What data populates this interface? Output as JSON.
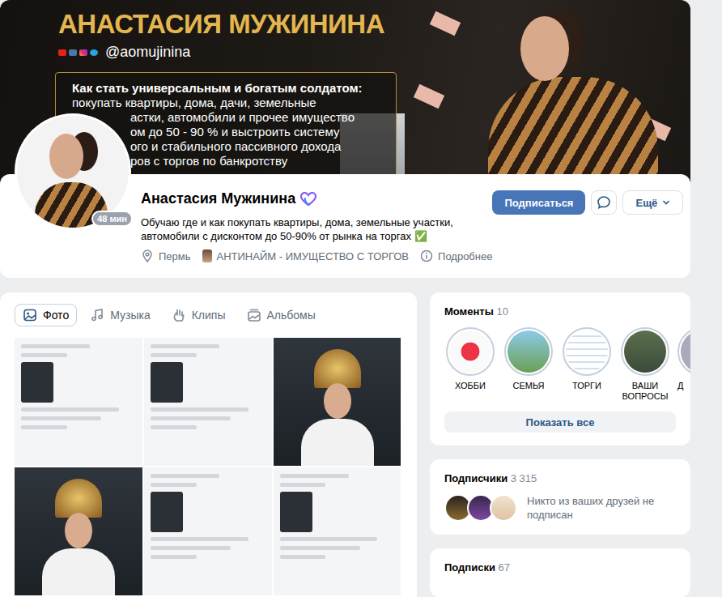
{
  "cover": {
    "title": "АНАСТАСИЯ МУЖИНИНА",
    "handle": "@aomujinina",
    "heading": "Как стать универсальным и богатым солдатом:",
    "lines": [
      "покупать квартиры, дома, дачи, земельные",
      "астки, автомобили и прочее имущество",
      "ом до 50 - 90 % и выстроить систему",
      "ого и стабильного пассивного дохода",
      "ров с торгов по банкротству"
    ]
  },
  "profile": {
    "name": "Анастасия Мужинина",
    "online": "48 мин",
    "status": "Обучаю где и как покупать квартиры, дома, земельные участки, автомобили с дисконтом до 50-90% от рынка на торгах",
    "status_mark": "✅",
    "city": "Пермь",
    "work": "АНТИНАЙМ - ИМУЩЕСТВО С ТОРГОВ",
    "more": "Подробнее"
  },
  "actions": {
    "subscribe": "Подписаться",
    "more": "Ещё"
  },
  "media_tabs": [
    {
      "label": "Фото",
      "selected": true,
      "kind": "photo"
    },
    {
      "label": "Музыка",
      "selected": false,
      "kind": "music"
    },
    {
      "label": "Клипы",
      "selected": false,
      "kind": "clips"
    },
    {
      "label": "Альбомы",
      "selected": false,
      "kind": "albums"
    }
  ],
  "photos": [
    {
      "kind": "screenshot"
    },
    {
      "kind": "screenshot"
    },
    {
      "kind": "portrait"
    },
    {
      "kind": "portrait"
    },
    {
      "kind": "screenshot"
    },
    {
      "kind": "screenshot"
    }
  ],
  "moments": {
    "title": "Моменты",
    "count": "10",
    "items": [
      {
        "label": "ХОББИ"
      },
      {
        "label": "СЕМЬЯ"
      },
      {
        "label": "ТОРГИ"
      },
      {
        "label": "ВАШИ ВОПРОСЫ"
      },
      {
        "label": "Д"
      }
    ],
    "show_all": "Показать все"
  },
  "followers": {
    "title": "Подписчики",
    "count": "3 315",
    "note": "Никто из ваших друзей не подписан"
  },
  "following": {
    "title": "Подписки",
    "count": "67"
  }
}
